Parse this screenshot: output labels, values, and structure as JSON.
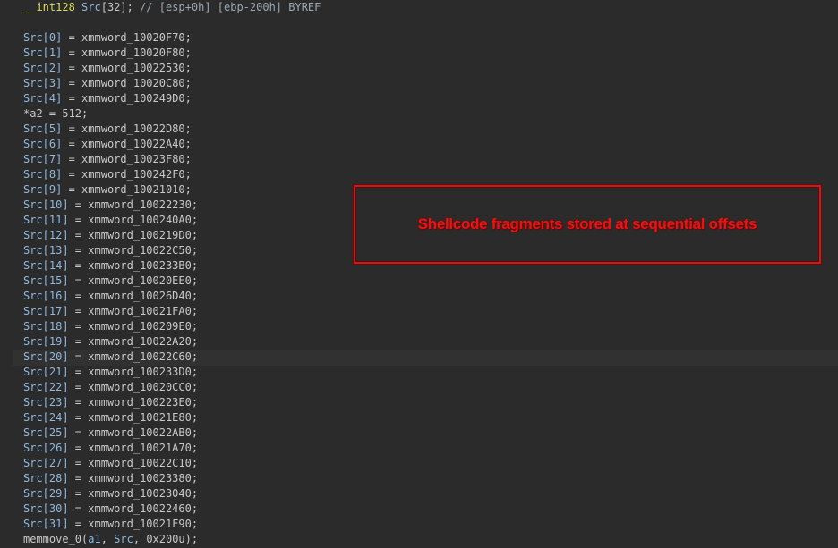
{
  "header_line": {
    "type_kw": "__int128",
    "name": "Src",
    "dims": "[32]; ",
    "comment": "// [esp+0h] [ebp-200h] BYREF"
  },
  "assignments_a": [
    {
      "idx": "Src[0]",
      "val": "xmmword_10020F70;"
    },
    {
      "idx": "Src[1]",
      "val": "xmmword_10020F80;"
    },
    {
      "idx": "Src[2]",
      "val": "xmmword_10022530;"
    },
    {
      "idx": "Src[3]",
      "val": "xmmword_10020C80;"
    },
    {
      "idx": "Src[4]",
      "val": "xmmword_100249D0;"
    }
  ],
  "a2_line": "*a2 = 512;",
  "assignments_b": [
    {
      "idx": "Src[5]",
      "val": "xmmword_10022D80;"
    },
    {
      "idx": "Src[6]",
      "val": "xmmword_10022A40;"
    },
    {
      "idx": "Src[7]",
      "val": "xmmword_10023F80;"
    },
    {
      "idx": "Src[8]",
      "val": "xmmword_100242F0;"
    },
    {
      "idx": "Src[9]",
      "val": "xmmword_10021010;"
    },
    {
      "idx": "Src[10]",
      "val": "xmmword_10022230;"
    },
    {
      "idx": "Src[11]",
      "val": "xmmword_100240A0;"
    },
    {
      "idx": "Src[12]",
      "val": "xmmword_100219D0;"
    },
    {
      "idx": "Src[13]",
      "val": "xmmword_10022C50;"
    },
    {
      "idx": "Src[14]",
      "val": "xmmword_100233B0;"
    },
    {
      "idx": "Src[15]",
      "val": "xmmword_10020EE0;"
    },
    {
      "idx": "Src[16]",
      "val": "xmmword_10026D40;"
    },
    {
      "idx": "Src[17]",
      "val": "xmmword_10021FA0;"
    },
    {
      "idx": "Src[18]",
      "val": "xmmword_100209E0;"
    },
    {
      "idx": "Src[19]",
      "val": "xmmword_10022A20;"
    },
    {
      "idx": "Src[20]",
      "val": "xmmword_10022C60;"
    },
    {
      "idx": "Src[21]",
      "val": "xmmword_100233D0;"
    },
    {
      "idx": "Src[22]",
      "val": "xmmword_10020CC0;"
    },
    {
      "idx": "Src[23]",
      "val": "xmmword_100223E0;"
    },
    {
      "idx": "Src[24]",
      "val": "xmmword_10021E80;"
    },
    {
      "idx": "Src[25]",
      "val": "xmmword_10022AB0;"
    },
    {
      "idx": "Src[26]",
      "val": "xmmword_10021A70;"
    },
    {
      "idx": "Src[27]",
      "val": "xmmword_10022C10;"
    },
    {
      "idx": "Src[28]",
      "val": "xmmword_10023380;"
    },
    {
      "idx": "Src[29]",
      "val": "xmmword_10023040;"
    },
    {
      "idx": "Src[30]",
      "val": "xmmword_10022460;"
    },
    {
      "idx": "Src[31]",
      "val": "xmmword_10021F90;"
    }
  ],
  "memmove_line": {
    "func": "memmove_0",
    "args_open": "(",
    "arg1": "a1",
    "sep1": ", ",
    "arg2": "Src",
    "sep2": ", ",
    "arg3": "0x200u",
    "close": ");"
  },
  "annotation": {
    "text": "Shellcode fragments stored at sequential offsets",
    "color": "#e81414"
  },
  "colors": {
    "background": "#2b2b2b",
    "variable": "#8fb8de",
    "type_keyword": "#dcdc5f",
    "code_text": "#c8c8c8"
  }
}
